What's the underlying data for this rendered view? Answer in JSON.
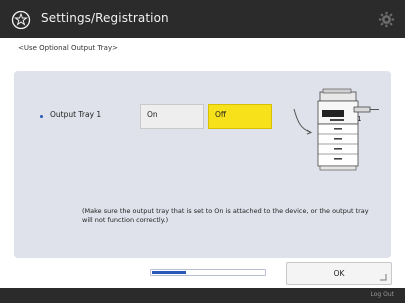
{
  "header": {
    "title": "Settings/Registration",
    "home_icon": "settings-registration-icon",
    "gear_icon": "gear-icon",
    "background": "#2b2b2b"
  },
  "page": {
    "subtitle": "<Use Optional Output Tray>"
  },
  "setting": {
    "label": "Output Tray 1",
    "on_label": "On",
    "off_label": "Off",
    "selected": "Off",
    "selected_color": "#f7e11a",
    "tray_number": "1"
  },
  "note": "(Make sure the output tray that is set to On is attached to the device, or the output tray will not function correctly.)",
  "progress": {
    "value": 0.3
  },
  "actions": {
    "ok_label": "OK"
  },
  "footer": {
    "label": "Log Out"
  }
}
